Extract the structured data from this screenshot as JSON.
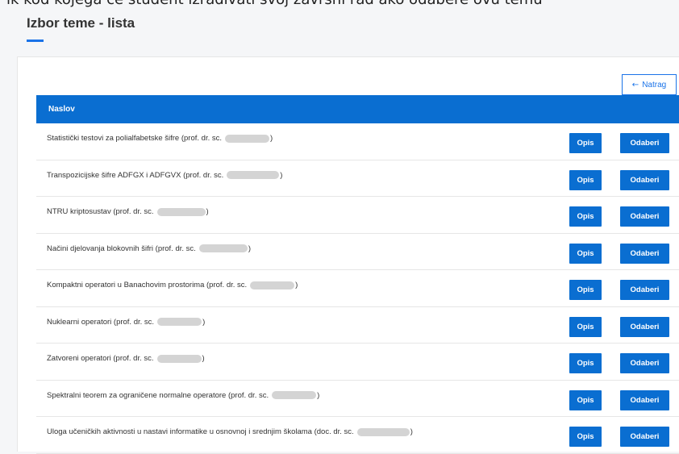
{
  "top_partial_text": "ik kod kojega će student izrađivati svoj završni rad ako odabere ovu temu",
  "page_title": "Izbor teme - lista",
  "back_button_label": "Natrag",
  "table": {
    "header": "Naslov",
    "opis_label": "Opis",
    "odaberi_label": "Odaberi",
    "rows": [
      {
        "title": "Statistički testovi za polialfabetske šifre (prof. dr. sc.",
        "suffix": ")"
      },
      {
        "title": "Transpozicijske šifre ADFGX i ADFGVX (prof. dr. sc.",
        "suffix": ")"
      },
      {
        "title": "NTRU kriptosustav (prof. dr. sc.",
        "suffix": ")"
      },
      {
        "title": "Načini djelovanja blokovnih šifri (prof. dr. sc.",
        "suffix": ")"
      },
      {
        "title": "Kompaktni operatori u Banachovim prostorima (prof. dr. sc.",
        "suffix": ")"
      },
      {
        "title": "Nuklearni operatori (prof. dr. sc.",
        "suffix": ")"
      },
      {
        "title": "Zatvoreni operatori (prof. dr. sc.",
        "suffix": ")"
      },
      {
        "title": "Spektralni teorem za ograničene normalne operatore (prof. dr. sc.",
        "suffix": ")"
      },
      {
        "title": "Uloga učeničkih aktivnosti u nastavi informatike u osnovnoj i srednjim školama (doc. dr. sc.",
        "suffix": ")"
      }
    ]
  },
  "colors": {
    "primary": "#0a6ed1",
    "accent": "#1a73e8"
  }
}
